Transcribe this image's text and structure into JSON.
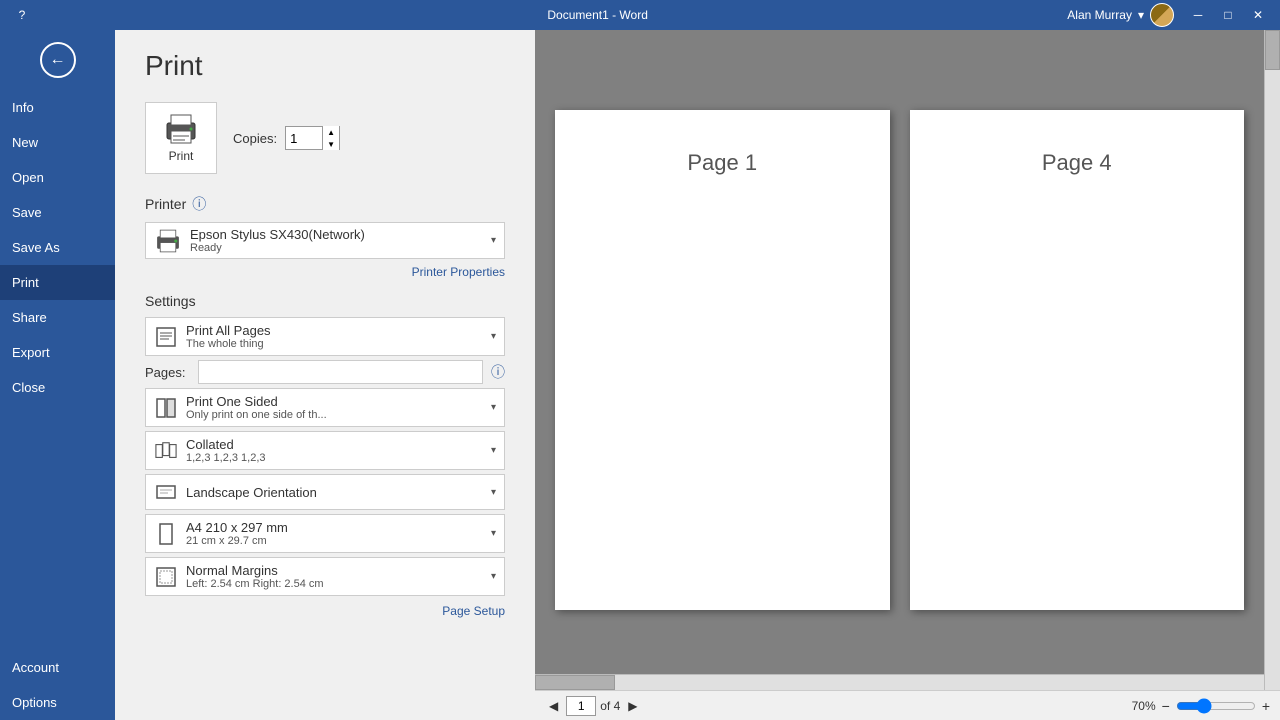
{
  "titleBar": {
    "title": "Document1 - Word",
    "minimize": "─",
    "maximize": "□",
    "close": "✕",
    "questionMark": "?"
  },
  "user": {
    "name": "Alan Murray"
  },
  "sidebar": {
    "items": [
      {
        "id": "info",
        "label": "Info",
        "active": false
      },
      {
        "id": "new",
        "label": "New",
        "active": false
      },
      {
        "id": "open",
        "label": "Open",
        "active": false
      },
      {
        "id": "save",
        "label": "Save",
        "active": false
      },
      {
        "id": "save-as",
        "label": "Save As",
        "active": false
      },
      {
        "id": "print",
        "label": "Print",
        "active": true
      },
      {
        "id": "share",
        "label": "Share",
        "active": false
      },
      {
        "id": "export",
        "label": "Export",
        "active": false
      },
      {
        "id": "close",
        "label": "Close",
        "active": false
      }
    ],
    "bottom": [
      {
        "id": "account",
        "label": "Account"
      },
      {
        "id": "options",
        "label": "Options"
      }
    ]
  },
  "print": {
    "title": "Print",
    "copies_label": "Copies:",
    "copies_value": "1",
    "print_button": "Print",
    "printer_section": "Printer",
    "printer_name": "Epson Stylus SX430(Network)",
    "printer_status": "Ready",
    "printer_props": "Printer Properties",
    "settings_section": "Settings",
    "settings": [
      {
        "id": "print-range",
        "main": "Print All Pages",
        "sub": "The whole thing"
      },
      {
        "id": "print-sides",
        "main": "Print One Sided",
        "sub": "Only print on one side of th..."
      },
      {
        "id": "collate",
        "main": "Collated",
        "sub": "1,2,3   1,2,3   1,2,3"
      },
      {
        "id": "orientation",
        "main": "Landscape Orientation",
        "sub": ""
      },
      {
        "id": "paper-size",
        "main": "A4 210 x 297 mm",
        "sub": "21 cm x 29.7 cm"
      },
      {
        "id": "margins",
        "main": "Normal Margins",
        "sub": "Left: 2.54 cm   Right: 2.54 cm"
      }
    ],
    "pages_label": "Pages:",
    "pages_placeholder": "",
    "page_setup": "Page Setup"
  },
  "preview": {
    "pages": [
      {
        "id": "page1",
        "label": "Page 1"
      },
      {
        "id": "page4",
        "label": "Page 4"
      }
    ],
    "current_page": "1",
    "total_pages": "of 4",
    "zoom": "70%"
  }
}
